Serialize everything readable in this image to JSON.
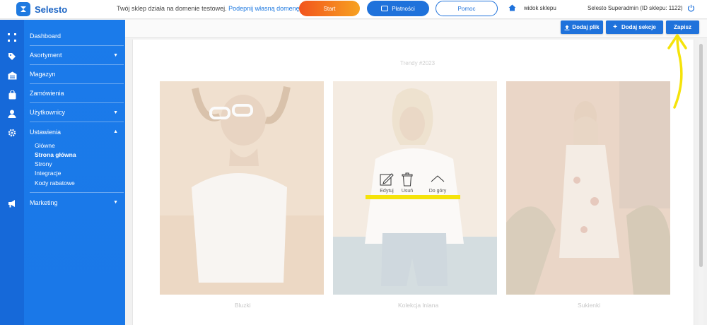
{
  "brand": {
    "name": "Selesto"
  },
  "topbar": {
    "notice_text": "Twój sklep działa na domenie testowej.",
    "notice_link": "Podepnij własną domenę",
    "start_label": "Start",
    "payments_label": "Płatności",
    "help_label": "Pomoc",
    "shop_view_label": "widok sklepu",
    "user_label": "Selesto Superadmin (ID sklepu: 1122)"
  },
  "sidebar": {
    "items": [
      {
        "label": "Dashboard",
        "icon": "grid-icon"
      },
      {
        "label": "Asortyment",
        "icon": "tags-icon",
        "expandable": true
      },
      {
        "label": "Magazyn",
        "icon": "warehouse-icon"
      },
      {
        "label": "Zamówienia",
        "icon": "bag-icon"
      },
      {
        "label": "Użytkownicy",
        "icon": "user-icon",
        "expandable": true
      },
      {
        "label": "Ustawienia",
        "icon": "gear-icon",
        "expanded": true
      },
      {
        "label": "Marketing",
        "icon": "megaphone-icon",
        "expandable": true
      }
    ],
    "settings_sub": [
      "Główne",
      "Strona główna",
      "Strony",
      "Integracje",
      "Kody rabatowe"
    ],
    "active_sub": "Strona główna"
  },
  "toolbar": {
    "add_file_label": "Dodaj plik",
    "add_section_label": "Dodaj sekcje",
    "save_label": "Zapisz"
  },
  "section": {
    "title": "Trendy #2023",
    "items": [
      {
        "caption": "Bluzki"
      },
      {
        "caption": "Kolekcja lniana"
      },
      {
        "caption": "Sukienki"
      }
    ],
    "tools": {
      "edit_label": "Edytuj",
      "delete_label": "Usuń",
      "up_label": "Do góry"
    }
  },
  "colors": {
    "brand_blue": "#1f72db",
    "sidebar_blue": "#1a78e8",
    "start_orange": "#f2541d",
    "annotation_yellow": "#f5e30a"
  }
}
